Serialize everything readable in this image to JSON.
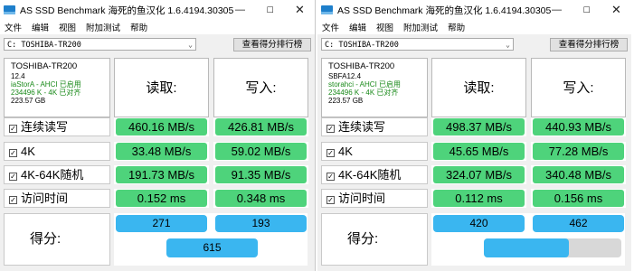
{
  "windows": [
    {
      "title": "AS SSD Benchmark 海死的鱼汉化 1.6.4194.30305",
      "menu": [
        "文件",
        "编辑",
        "视图",
        "附加测试",
        "帮助"
      ],
      "drive": "C: TOSHIBA-TR200",
      "rank_button": "查看得分排行榜",
      "info": {
        "name": "TOSHIBA-TR200",
        "firmware": "12.4",
        "driver": "iaStorA - AHCI 已启用",
        "alignment": "234496 K - 4K 已对齐",
        "size": "223.57 GB"
      },
      "headers": {
        "read": "读取:",
        "write": "写入:"
      },
      "rows": [
        {
          "label": "连续读写",
          "read": "460.16 MB/s",
          "write": "426.81 MB/s"
        },
        {
          "label": "4K",
          "read": "33.48 MB/s",
          "write": "59.02 MB/s"
        },
        {
          "label": "4K-64K随机",
          "read": "191.73 MB/s",
          "write": "91.35 MB/s"
        },
        {
          "label": "访问时间",
          "read": "0.152 ms",
          "write": "0.348 ms"
        }
      ],
      "score": {
        "label": "得分:",
        "read": "271",
        "write": "193",
        "total": "615"
      },
      "progress": null
    },
    {
      "title": "AS SSD Benchmark 海死的鱼汉化 1.6.4194.30305",
      "menu": [
        "文件",
        "编辑",
        "视图",
        "附加测试",
        "帮助"
      ],
      "drive": "C: TOSHIBA-TR200",
      "rank_button": "查看得分排行榜",
      "info": {
        "name": "TOSHIBA-TR200",
        "firmware": "SBFA12.4",
        "driver": "storahci - AHCI 已启用",
        "alignment": "234496 K - 4K 已对齐",
        "size": "223.57 GB"
      },
      "headers": {
        "read": "读取:",
        "write": "写入:"
      },
      "rows": [
        {
          "label": "连续读写",
          "read": "498.37 MB/s",
          "write": "440.93 MB/s"
        },
        {
          "label": "4K",
          "read": "45.65 MB/s",
          "write": "77.28 MB/s"
        },
        {
          "label": "4K-64K随机",
          "read": "324.07 MB/s",
          "write": "340.48 MB/s"
        },
        {
          "label": "访问时间",
          "read": "0.112 ms",
          "write": "0.156 ms"
        }
      ],
      "score": {
        "label": "得分:",
        "read": "420",
        "write": "462",
        "total": ""
      },
      "progress": 0.62
    }
  ],
  "window_controls": {
    "minimize": "—",
    "maximize": "☐",
    "close": "✕"
  },
  "colors": {
    "value_green": "#4ed37b",
    "score_blue": "#3ab6f0",
    "driver_green": "#1a8a1a"
  }
}
